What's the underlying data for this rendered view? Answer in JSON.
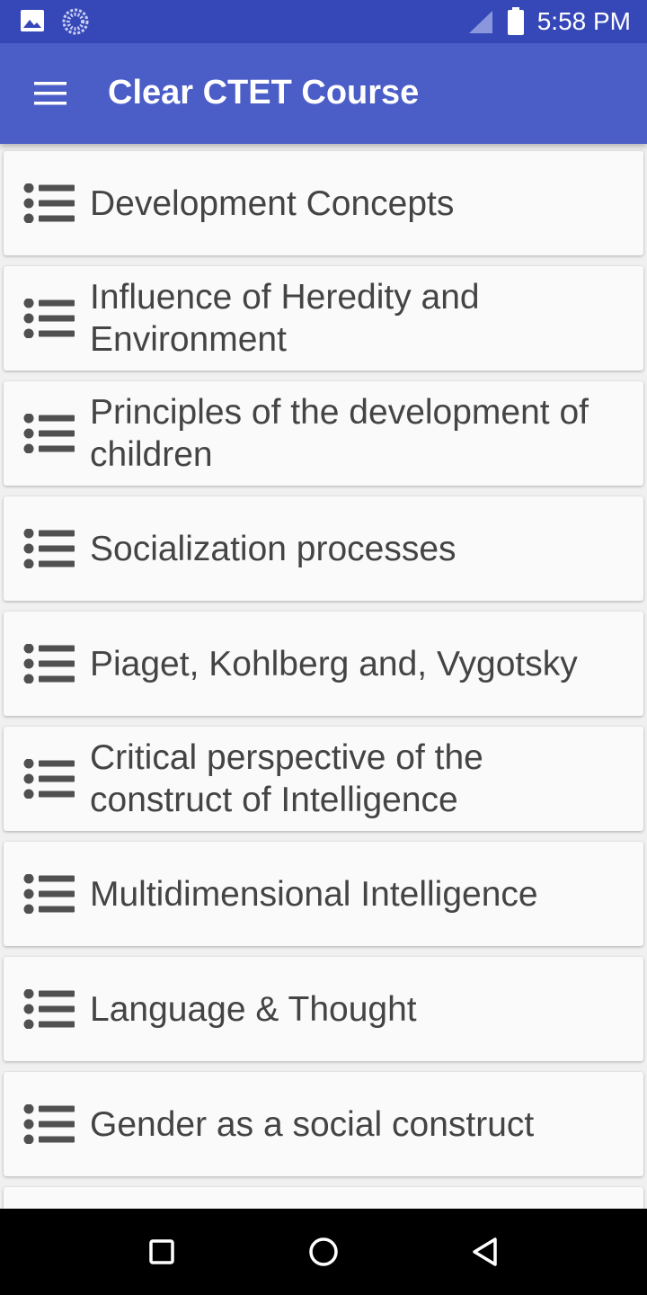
{
  "status_bar": {
    "time": "5:58 PM",
    "left_icons": [
      "image-icon",
      "loading-icon"
    ],
    "right_icons": [
      "signal-icon",
      "battery-icon"
    ]
  },
  "app_bar": {
    "menu_icon": "hamburger-menu-icon",
    "title": "Clear CTET Course"
  },
  "topics": [
    {
      "label": "Development Concepts",
      "icon": "list-icon"
    },
    {
      "label": "Influence of Heredity and Environment",
      "icon": "list-icon"
    },
    {
      "label": "Principles of the development of children",
      "icon": "list-icon"
    },
    {
      "label": "Socialization processes",
      "icon": "list-icon"
    },
    {
      "label": "Piaget, Kohlberg and, Vygotsky",
      "icon": "list-icon"
    },
    {
      "label": "Critical perspective of the construct of Intelligence",
      "icon": "list-icon"
    },
    {
      "label": "Multidimensional Intelligence",
      "icon": "list-icon"
    },
    {
      "label": "Language & Thought",
      "icon": "list-icon"
    },
    {
      "label": "Gender as a social construct",
      "icon": "list-icon"
    },
    {
      "label": "",
      "icon": "list-icon"
    }
  ],
  "nav_bar": {
    "buttons": [
      "recents-square-icon",
      "home-circle-icon",
      "back-triangle-icon"
    ]
  },
  "colors": {
    "status_bar": "#3648b8",
    "app_bar": "#4b5dc6",
    "card_background": "#fafafa",
    "text": "#444444",
    "icon": "#505050"
  }
}
